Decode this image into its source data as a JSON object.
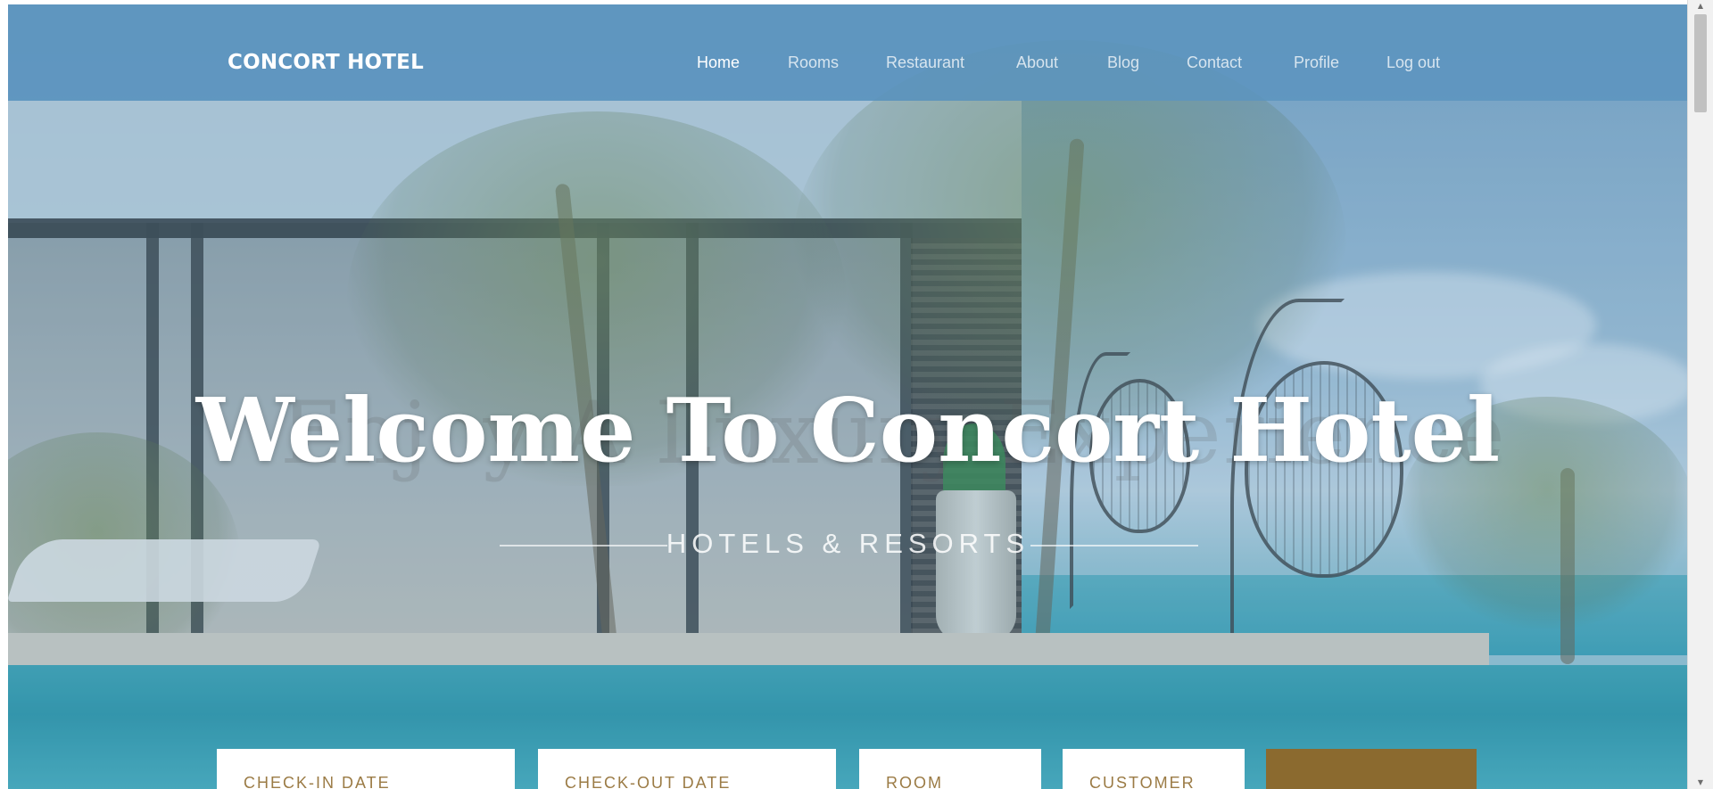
{
  "brand": {
    "name": "CONCORT HOTEL"
  },
  "nav": {
    "items": [
      {
        "label": "Home",
        "active": true
      },
      {
        "label": "Rooms",
        "active": false
      },
      {
        "label": "Restaurant",
        "active": false
      },
      {
        "label": "About",
        "active": false
      },
      {
        "label": "Blog",
        "active": false
      },
      {
        "label": "Contact",
        "active": false
      },
      {
        "label": "Profile",
        "active": false
      },
      {
        "label": "Log out",
        "active": false
      }
    ]
  },
  "hero": {
    "title": "Welcome To Concort Hotel",
    "background_title": "Enjoy A Luxury Experience",
    "subtitle": "HOTELS & RESORTS"
  },
  "booking": {
    "fields": [
      {
        "label": "CHECK-IN DATE"
      },
      {
        "label": "CHECK-OUT DATE"
      },
      {
        "label": "ROOM"
      },
      {
        "label": "CUSTOMER"
      }
    ]
  },
  "colors": {
    "accent": "#8b6a2f",
    "label_gold": "#9b7b45",
    "nav_bar": "#5c94be"
  },
  "icons": {
    "scroll_up": "triangle-up-icon",
    "scroll_down": "triangle-down-icon"
  }
}
